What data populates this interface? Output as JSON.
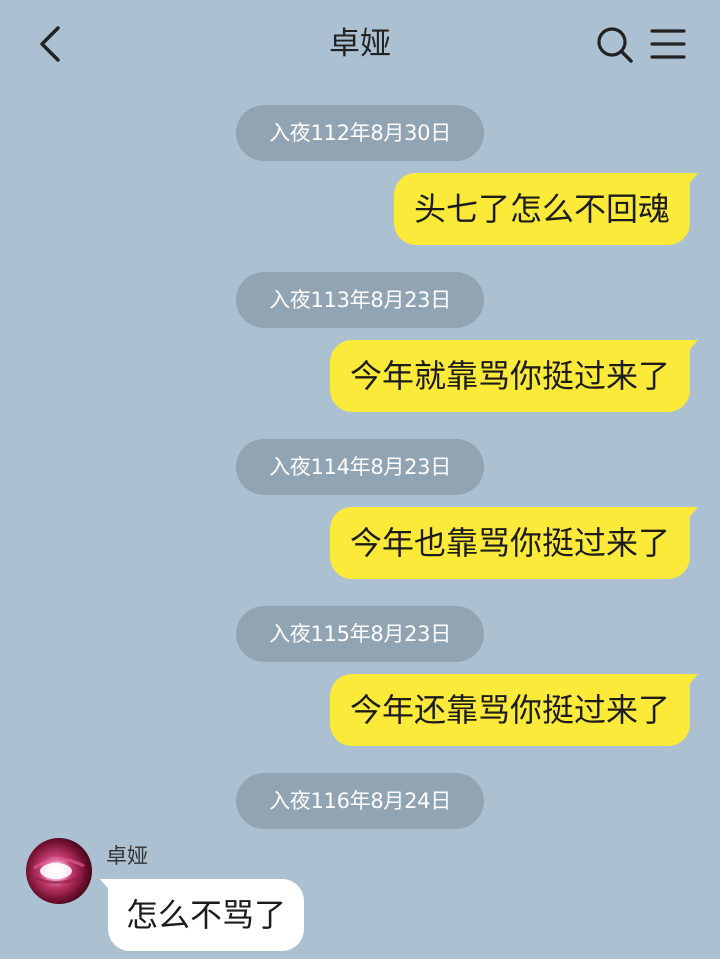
{
  "header": {
    "title": "卓娅",
    "back_icon": "chevron-left-icon",
    "search_icon": "search-icon",
    "menu_icon": "hamburger-menu-icon"
  },
  "colors": {
    "background": "#abc1d1",
    "outgoing_bubble": "#fbea3a",
    "incoming_bubble": "#ffffff",
    "timestamp_pill": "#91a4b4"
  },
  "messages": {
    "ts1": "入夜112年8月30日",
    "msg1": "头七了怎么不回魂",
    "ts2": "入夜113年8月23日",
    "msg2": "今年就靠骂你挺过来了",
    "ts3": "入夜114年8月23日",
    "msg3": "今年也靠骂你挺过来了",
    "ts4": "入夜115年8月23日",
    "msg4": "今年还靠骂你挺过来了",
    "ts5": "入夜116年8月24日",
    "incoming": {
      "sender": "卓娅",
      "text": "怎么不骂了"
    }
  }
}
